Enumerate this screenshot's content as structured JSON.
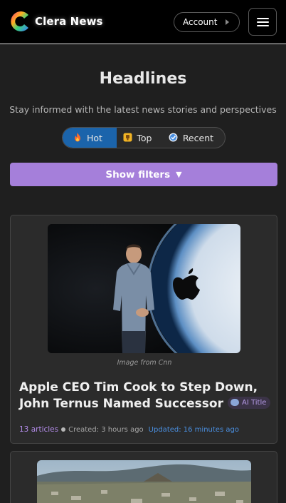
{
  "header": {
    "brand": "Clera News",
    "account_label": "Account"
  },
  "hero": {
    "title": "Headlines",
    "subtitle": "Stay informed with the latest news stories and perspectives"
  },
  "tabs": [
    {
      "label": "Hot",
      "icon": "fire-icon",
      "active": true
    },
    {
      "label": "Top",
      "icon": "trophy-icon",
      "active": false
    },
    {
      "label": "Recent",
      "icon": "clock-icon",
      "active": false
    }
  ],
  "filters": {
    "label": "Show filters",
    "icon": "triangle-down-icon"
  },
  "articles": [
    {
      "image_credit": "Image from Cnn",
      "title": "Apple CEO Tim Cook to Step Down, John Ternus Named Successor",
      "badge": "AI Title",
      "articles_count": "13 articles",
      "created": "Created: 3 hours ago",
      "updated": "Updated: 16 minutes ago"
    }
  ],
  "colors": {
    "accent_purple": "#a57fda",
    "active_tab": "#1b64ab",
    "updated_blue": "#4a8fe0",
    "background": "#1f1f1f"
  }
}
